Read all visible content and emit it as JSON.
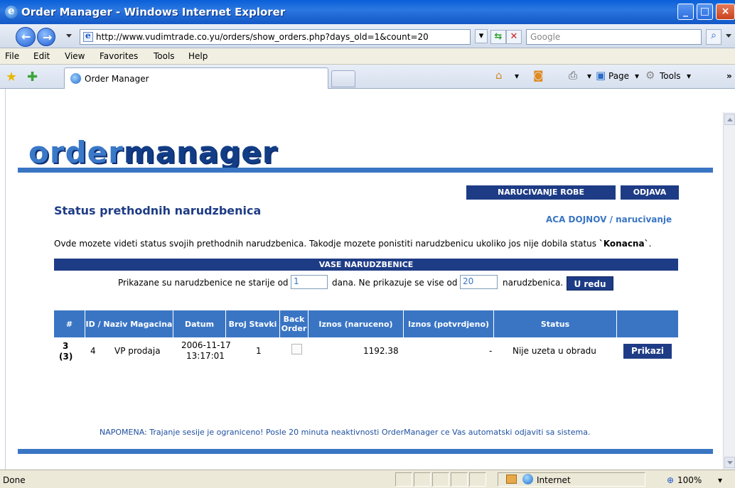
{
  "window": {
    "title": "Order Manager - Windows Internet Explorer"
  },
  "address": {
    "url": "http://www.vudimtrade.co.yu/orders/show_orders.php?days_old=1&count=20",
    "search_placeholder": "Google"
  },
  "menu": [
    "File",
    "Edit",
    "View",
    "Favorites",
    "Tools",
    "Help"
  ],
  "tab": {
    "label": "Order Manager"
  },
  "toolbar": {
    "page_label": "Page",
    "tools_label": "Tools"
  },
  "page": {
    "logo_light": "order",
    "logo_dark": "manager",
    "buttons": {
      "order_goods": "NARUCIVANJE ROBE",
      "logout": "ODJAVA"
    },
    "title": "Status prethodnih narudzbenica",
    "user": "ACA DOJNOV / narucivanje",
    "intro": "Ovde mozete videti status svojih prethodnih narudzbenica. Takodje mozete ponistiti narudzbenicu ukoliko jos nije dobila status ",
    "intro_status": "`Konacna`",
    "intro_end": ".",
    "section_title": "VASE NARUDZBENICE",
    "filter": {
      "prefix": "Prikazane su narudzbenice ne starije od",
      "days_value": "1",
      "middle": "dana. Ne prikazuje se vise od",
      "count_value": "20",
      "suffix": "narudzbenica.",
      "ok_label": "U redu"
    },
    "table": {
      "headers": [
        "#",
        "ID / Naziv Magacina",
        "Datum",
        "Broj Stavki",
        "Back Order",
        "Iznos (naruceno)",
        "Iznos (potvrdjeno)",
        "Status",
        ""
      ],
      "rows": [
        {
          "num": "3",
          "num_sub": "(3)",
          "id": "4",
          "warehouse": "VP prodaja",
          "date": "2006-11-17",
          "time": "13:17:01",
          "items": "1",
          "ordered": "1192.38",
          "confirmed": "-",
          "status": "Nije uzeta u obradu",
          "action": "Prikazi"
        }
      ]
    },
    "note": "NAPOMENA: Trajanje sesije je ograniceno! Posle 20 minuta neaktivnosti OrderManager ce Vas automatski odjaviti sa sistema."
  },
  "statusbar": {
    "left": "Done",
    "zone": "Internet",
    "zoom": "100%"
  }
}
